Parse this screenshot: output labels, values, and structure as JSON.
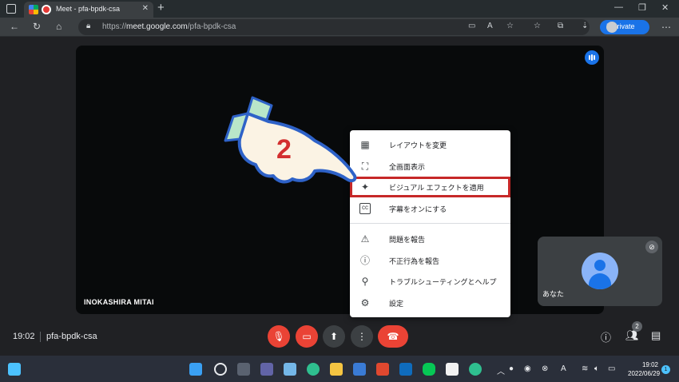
{
  "browser": {
    "tab_title": "Meet - pfa-bpdk-csa",
    "url_prefix": "https://",
    "url_host": "meet.google.com",
    "url_path": "/pfa-bpdk-csa",
    "inprivate_label": "InPrivate"
  },
  "meet": {
    "participant_name": "INOKASHIRA MITAI",
    "self_label": "あなた",
    "time": "19:02",
    "meeting_code": "pfa-bpdk-csa",
    "participants_count": "2"
  },
  "menu": {
    "items": [
      {
        "label": "レイアウトを変更",
        "icon": "layout-icon"
      },
      {
        "label": "全画面表示",
        "icon": "fullscreen-icon"
      },
      {
        "label": "ビジュアル エフェクトを適用",
        "icon": "sparkle-icon"
      },
      {
        "label": "字幕をオンにする",
        "icon": "captions-icon"
      },
      {
        "label": "問題を報告",
        "icon": "report-problem-icon"
      },
      {
        "label": "不正行為を報告",
        "icon": "report-abuse-icon"
      },
      {
        "label": "トラブルシューティングとヘルプ",
        "icon": "troubleshoot-icon"
      },
      {
        "label": "設定",
        "icon": "settings-icon"
      }
    ]
  },
  "annotation": {
    "step_number": "2"
  },
  "taskbar": {
    "time": "19:02",
    "date": "2022/06/29",
    "notifications": "1"
  },
  "colors": {
    "highlight": "#c62828",
    "meet_red": "#ea4335",
    "accent_blue": "#1a73e8"
  }
}
